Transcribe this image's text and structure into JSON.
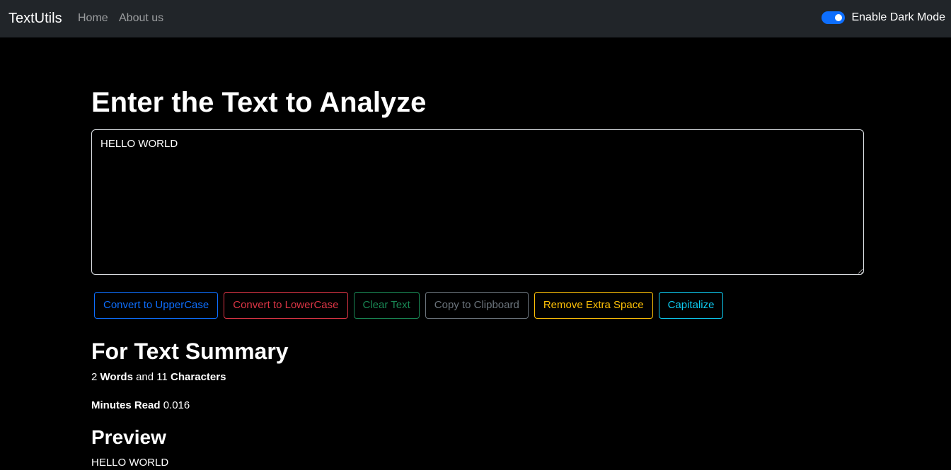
{
  "navbar": {
    "brand": "TextUtils",
    "links": [
      "Home",
      "About us"
    ],
    "dark_mode_label": "Enable Dark Mode",
    "dark_mode_enabled": true
  },
  "main": {
    "title": "Enter the Text to Analyze",
    "textarea_value": "HELLO WORLD",
    "buttons": [
      "Convert to UpperCase",
      "Convert to LowerCase",
      "Clear Text",
      "Copy to Clipboard",
      "Remove Extra Space",
      "Capitalize"
    ]
  },
  "summary": {
    "title": "For Text Summary",
    "word_count": "2",
    "words_label": "Words",
    "and_text": "and",
    "char_count": "11",
    "chars_label": "Characters",
    "minutes_label": "Minutes Read",
    "minutes_value": "0.016"
  },
  "preview": {
    "title": "Preview",
    "text": "HELLO WORLD"
  },
  "colors": {
    "navbar_bg": "#212529",
    "page_bg": "#000000",
    "primary": "#0d6efd",
    "danger": "#dc3545",
    "success": "#198754",
    "secondary": "#6c757d",
    "warning": "#ffc107",
    "info": "#0dcaf0"
  }
}
